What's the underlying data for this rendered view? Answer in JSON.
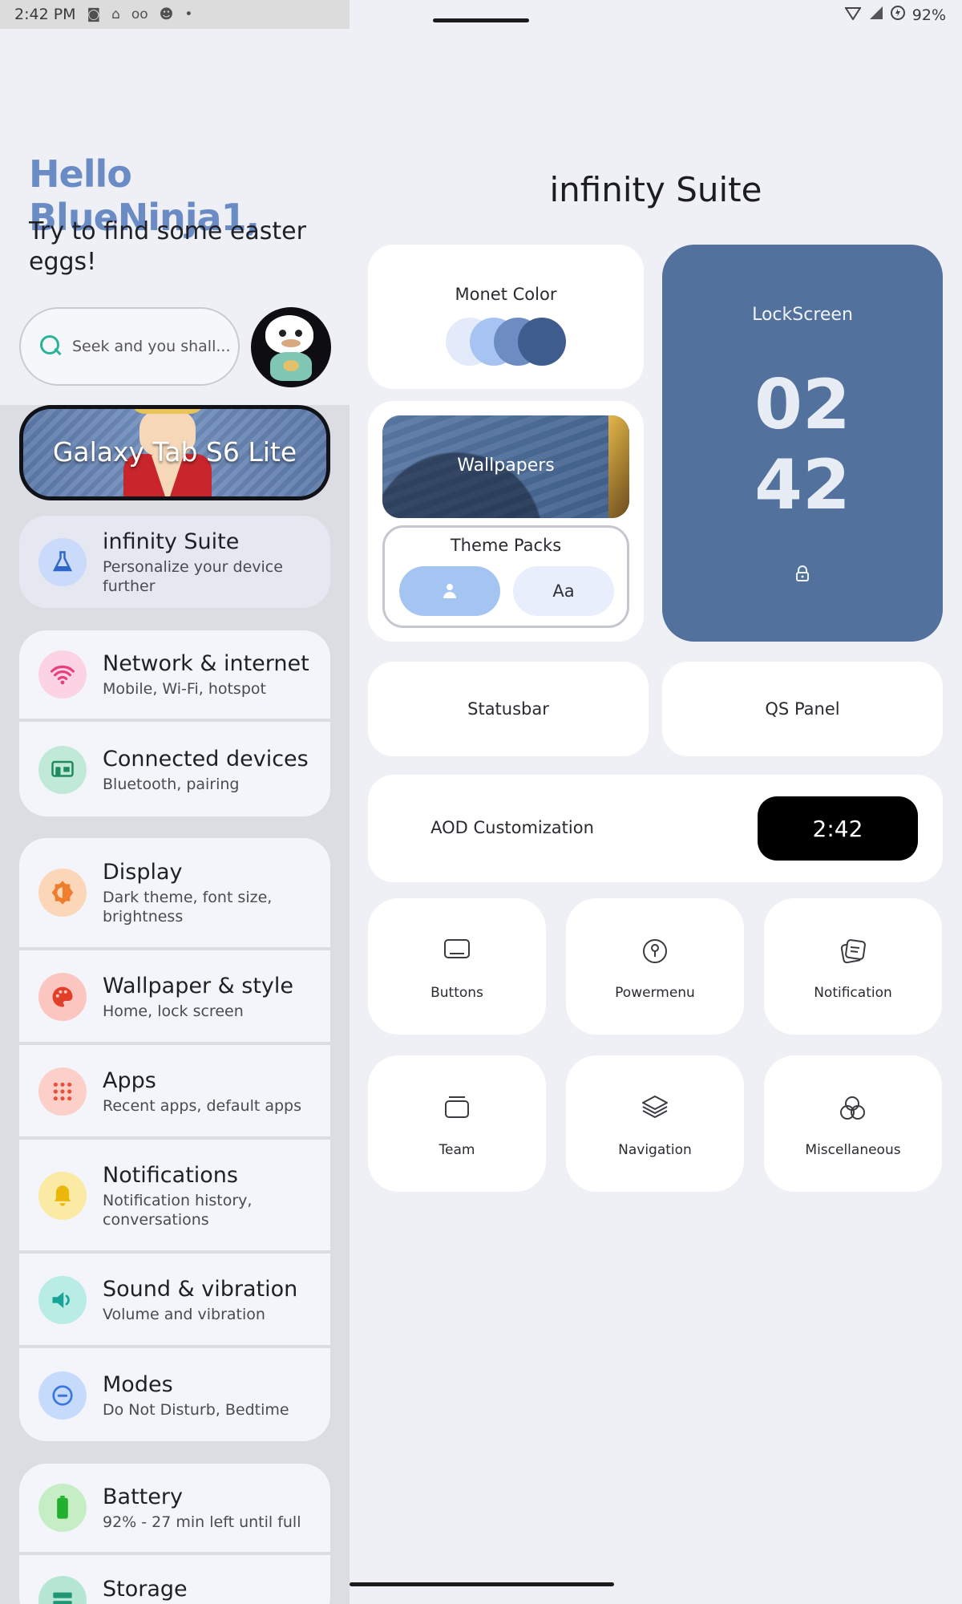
{
  "status": {
    "time": "2:42 PM",
    "battery": "92%"
  },
  "greeting": {
    "title": "Hello BlueNinja1,",
    "subtitle": "Try to find some easter eggs!"
  },
  "search": {
    "placeholder": "Seek and you shall..."
  },
  "banner": {
    "label": "Galaxy Tab S6 Lite"
  },
  "settings": {
    "items": [
      {
        "title": "infinity Suite",
        "subtitle": "Personalize your device further",
        "icon": "flask-icon",
        "color": "#6f9ee8"
      },
      {
        "title": "Network & internet",
        "subtitle": "Mobile, Wi-Fi, hotspot",
        "icon": "wifi-icon",
        "color": "#f0568f"
      },
      {
        "title": "Connected devices",
        "subtitle": "Bluetooth, pairing",
        "icon": "devices-icon",
        "color": "#3aa57a"
      },
      {
        "title": "Display",
        "subtitle": "Dark theme, font size, brightness",
        "icon": "brightness-icon",
        "color": "#f08a3c"
      },
      {
        "title": "Wallpaper & style",
        "subtitle": "Home, lock screen",
        "icon": "palette-icon",
        "color": "#e8402e"
      },
      {
        "title": "Apps",
        "subtitle": "Recent apps, default apps",
        "icon": "apps-grid-icon",
        "color": "#ee5d4a"
      },
      {
        "title": "Notifications",
        "subtitle": "Notification history, conversations",
        "icon": "bell-icon",
        "color": "#f2c20e"
      },
      {
        "title": "Sound & vibration",
        "subtitle": "Volume and vibration",
        "icon": "speaker-icon",
        "color": "#22b7a8"
      },
      {
        "title": "Modes",
        "subtitle": "Do Not Disturb, Bedtime",
        "icon": "dnd-icon",
        "color": "#4a87e8"
      },
      {
        "title": "Battery",
        "subtitle": "92% - 27 min left until full",
        "icon": "battery-icon",
        "color": "#2fbe3e"
      },
      {
        "title": "Storage",
        "subtitle": "",
        "icon": "storage-icon",
        "color": "#27a882"
      }
    ]
  },
  "suite": {
    "title": "infinity Suite",
    "monet_label": "Monet Color",
    "monet_colors": [
      "#e3eaf9",
      "#a7c3f1",
      "#6d8dc2",
      "#3e5c8e"
    ],
    "lockscreen": {
      "label": "LockScreen",
      "hour": "02",
      "minute": "42"
    },
    "wallpapers_label": "Wallpapers",
    "themepacks": {
      "label": "Theme Packs",
      "font_button": "Aa"
    },
    "statusbar_label": "Statusbar",
    "qs_label": "QS Panel",
    "aod": {
      "label": "AOD Customization",
      "time": "2:42"
    },
    "tiles": [
      {
        "label": "Buttons",
        "icon": "button-icon"
      },
      {
        "label": "Powermenu",
        "icon": "power-icon"
      },
      {
        "label": "Notification",
        "icon": "notification-icon"
      },
      {
        "label": "Team",
        "icon": "team-icon"
      },
      {
        "label": "Navigation",
        "icon": "layers-icon"
      },
      {
        "label": "Miscellaneous",
        "icon": "circles-icon"
      }
    ]
  }
}
